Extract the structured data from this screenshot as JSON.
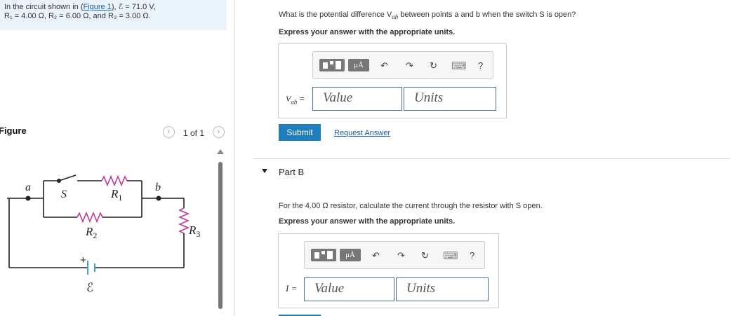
{
  "intro": {
    "line1_prefix": "In the circuit shown in (",
    "figure_link": "Figure 1",
    "line1_suffix": "), ℰ = 71.0 V,",
    "line2": "R₁ = 4.00 Ω, R₂ = 6.00 Ω, and R₃ = 3.00 Ω."
  },
  "figure": {
    "label": "Figure",
    "pager": "1 of 1",
    "prev_glyph": "‹",
    "next_glyph": "›",
    "circuit": {
      "node_a": "a",
      "node_b": "b",
      "switch": "S",
      "r1": "R",
      "r1_sub": "1",
      "r2": "R",
      "r2_sub": "2",
      "r3": "R",
      "r3_sub": "3",
      "emf": "ℰ",
      "plus": "+"
    }
  },
  "part_a": {
    "question": "What is the potential difference V",
    "question_sub": "ab",
    "question_rest": " between points a and b when the switch S is open?",
    "instruction": "Express your answer with the appropriate units.",
    "var_label": "V",
    "var_sub": "ab",
    "equals": "=",
    "value_placeholder": "Value",
    "units_placeholder": "Units",
    "submit_label": "Submit",
    "request_label": "Request Answer"
  },
  "part_b": {
    "title": "Part B",
    "question": "For the 4.00 Ω resistor, calculate the current through the resistor with S open.",
    "instruction": "Express your answer with the appropriate units.",
    "var_label": "I =",
    "value_placeholder": "Value",
    "units_placeholder": "Units"
  },
  "toolbar": {
    "mu_label": "μÅ",
    "undo": "↶",
    "redo": "↷",
    "reset": "↻",
    "keyboard": "⌨",
    "help": "?"
  }
}
